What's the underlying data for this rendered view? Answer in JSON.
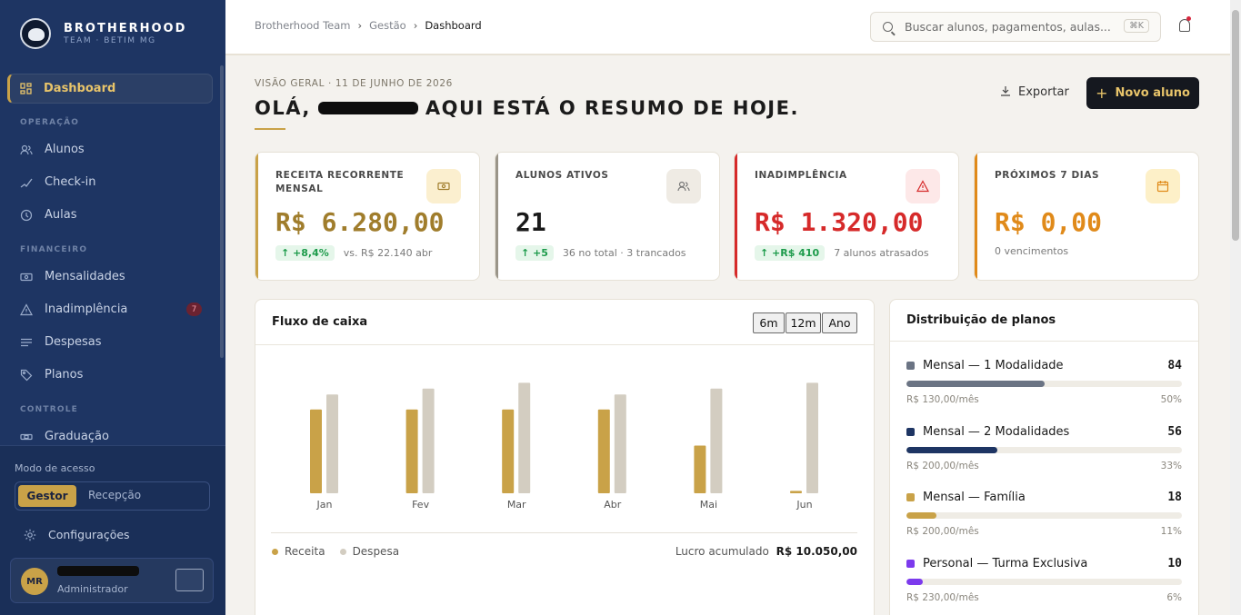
{
  "sidebar": {
    "brand_name": "BROTHERHOOD",
    "brand_sub": "TEAM · BETIM MG",
    "active_item": "Dashboard",
    "sections": {
      "operacao": "OPERAÇÃO",
      "financeiro": "FINANCEIRO",
      "controle": "CONTROLE"
    },
    "items": {
      "alunos": "Alunos",
      "checkin": "Check-in",
      "aulas": "Aulas",
      "mensalidades": "Mensalidades",
      "inadimplencia": "Inadimplência",
      "inadimplencia_badge": "7",
      "despesas": "Despesas",
      "planos": "Planos",
      "graduacao": "Graduação"
    },
    "mode_label": "Modo de acesso",
    "mode_options": [
      "Gestor",
      "Recepção"
    ],
    "mode_selected": "Gestor",
    "settings": "Configurações",
    "user": {
      "initials": "MR",
      "role": "Administrador"
    }
  },
  "topbar": {
    "breadcrumb": [
      "Brotherhood Team",
      "Gestão",
      "Dashboard"
    ],
    "search_placeholder": "Buscar alunos, pagamentos, aulas...",
    "shortcut": "⌘K"
  },
  "header": {
    "overline": "VISÃO GERAL · 11 DE JUNHO DE 2026",
    "greet_prefix": "OLÁ,",
    "greet_suffix": "AQUI ESTÁ O RESUMO DE HOJE.",
    "export": "Exportar",
    "new_student": "Novo aluno"
  },
  "kpis": [
    {
      "label": "RECEITA RECORRENTE MENSAL",
      "value": "R$ 6.280,00",
      "delta": "↑ +8,4%",
      "note": "vs. R$ 22.140 abr",
      "color": "#a07d2c"
    },
    {
      "label": "ALUNOS ATIVOS",
      "value": "21",
      "delta": "↑ +5",
      "note": "36 no total · 3 trancados",
      "color": "#1a1a1a"
    },
    {
      "label": "INADIMPLÊNCIA",
      "value": "R$ 1.320,00",
      "delta": "↑ +R$ 410",
      "note": "7 alunos atrasados",
      "color": "#d62a2a"
    },
    {
      "label": "PRÓXIMOS 7 DIAS",
      "value": "R$ 0,00",
      "delta": "",
      "note": "0 vencimentos",
      "color": "#e08a1a"
    }
  ],
  "cashflow": {
    "title": "Fluxo de caixa",
    "ranges": [
      "6m",
      "12m",
      "Ano"
    ],
    "legend": [
      "Receita",
      "Despesa"
    ],
    "profit_label": "Lucro acumulado",
    "profit_value": "R$ 10.050,00",
    "colors": {
      "receita": "#c9a248",
      "despesa": "#d3cdc1"
    }
  },
  "chart_data": {
    "type": "bar",
    "categories": [
      "Jan",
      "Fev",
      "Mar",
      "Abr",
      "Mai",
      "Jun"
    ],
    "series": [
      {
        "name": "Receita",
        "values": [
          0.72,
          0.72,
          0.72,
          0.72,
          0.41,
          0.02
        ]
      },
      {
        "name": "Despesa",
        "values": [
          0.85,
          0.9,
          0.95,
          0.85,
          0.9,
          0.95
        ]
      }
    ],
    "ylim": [
      0,
      1
    ]
  },
  "plans": {
    "title": "Distribuição de planos",
    "items": [
      {
        "name": "Mensal — 1 Modalidade",
        "count": "84",
        "price": "R$ 130,00/mês",
        "pct": "50%",
        "share": 0.5,
        "color": "#6b7484"
      },
      {
        "name": "Mensal — 2 Modalidades",
        "count": "56",
        "price": "R$ 200,00/mês",
        "pct": "33%",
        "share": 0.33,
        "color": "#1e3563"
      },
      {
        "name": "Mensal — Família",
        "count": "18",
        "price": "R$ 200,00/mês",
        "pct": "11%",
        "share": 0.11,
        "color": "#c9a248"
      },
      {
        "name": "Personal — Turma Exclusiva",
        "count": "10",
        "price": "R$ 230,00/mês",
        "pct": "6%",
        "share": 0.06,
        "color": "#7c3aed"
      }
    ]
  }
}
